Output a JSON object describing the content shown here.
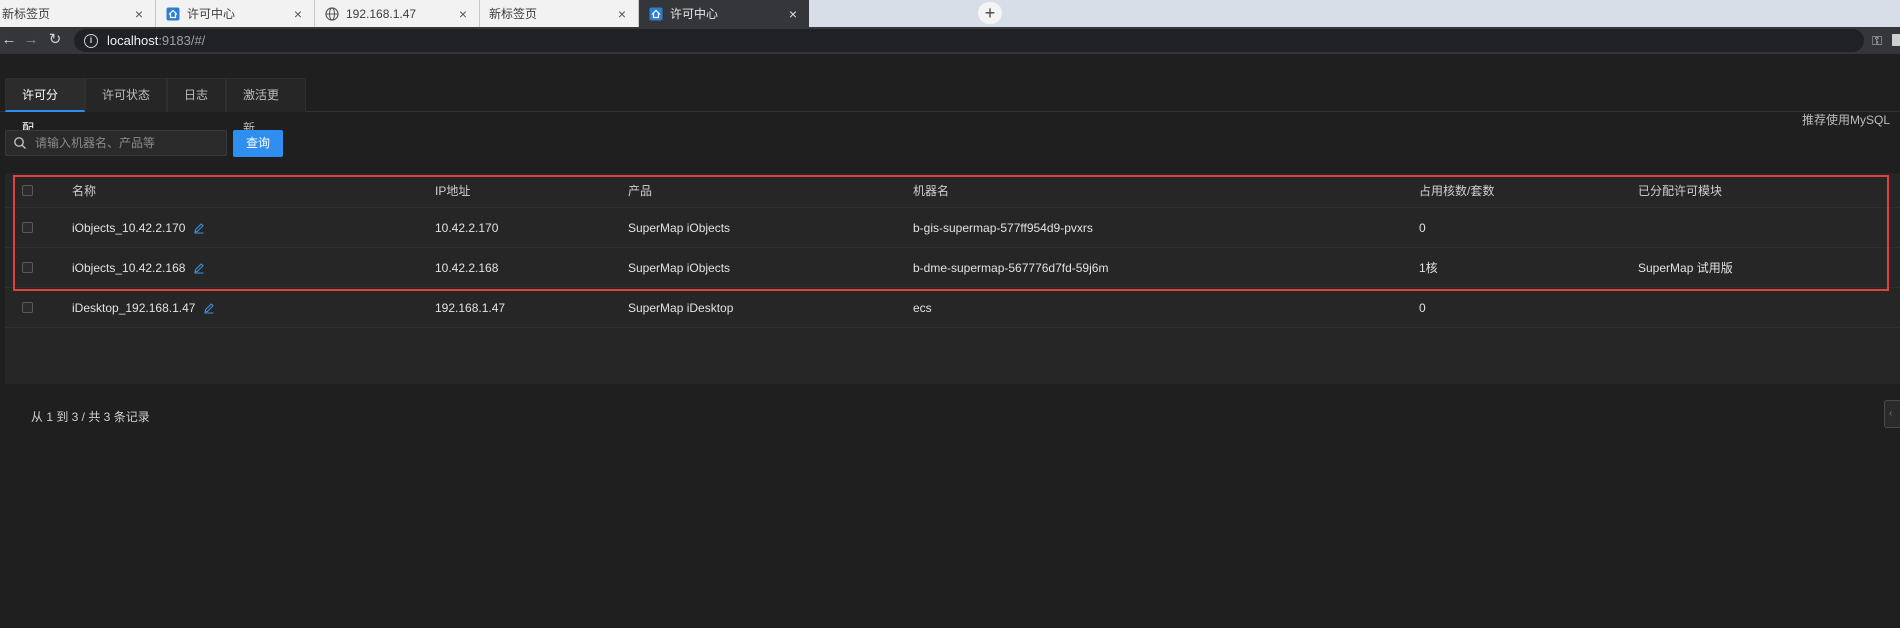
{
  "browser": {
    "tabs": [
      {
        "title": "新标签页",
        "icon": "none"
      },
      {
        "title": "许可中心",
        "icon": "house-icon"
      },
      {
        "title": "192.168.1.47",
        "icon": "globe-icon"
      },
      {
        "title": "新标签页",
        "icon": "none"
      },
      {
        "title": "许可中心",
        "icon": "house-icon",
        "active": true
      }
    ],
    "close_glyph": "×",
    "new_tab_glyph": "+",
    "address": {
      "host": "localhost",
      "rest": ":9183/#/"
    }
  },
  "app": {
    "tabs": [
      {
        "label": "许可分配",
        "active": true
      },
      {
        "label": "许可状态"
      },
      {
        "label": "日志"
      },
      {
        "label": "激活更新"
      }
    ],
    "mysql_tip": "推荐使用MySQL",
    "search": {
      "placeholder": "请输入机器名、产品等",
      "button": "查询"
    },
    "table": {
      "columns": [
        "名称",
        "IP地址",
        "产品",
        "机器名",
        "占用核数/套数",
        "已分配许可模块"
      ],
      "rows": [
        {
          "name": "iObjects_10.42.2.170",
          "ip": "10.42.2.170",
          "product": "SuperMap iObjects",
          "machine": "b-gis-supermap-577ff954d9-pvxrs",
          "cores": "0",
          "modules": ""
        },
        {
          "name": "iObjects_10.42.2.168",
          "ip": "10.42.2.168",
          "product": "SuperMap iObjects",
          "machine": "b-dme-supermap-567776d7fd-59j6m",
          "cores": "1核",
          "modules": "SuperMap 试用版"
        },
        {
          "name": "iDesktop_192.168.1.47",
          "ip": "192.168.1.47",
          "product": "SuperMap iDesktop",
          "machine": "ecs",
          "cores": "0",
          "modules": ""
        }
      ]
    },
    "footer": "从 1 到 3 / 共 3 条记录"
  },
  "colors": {
    "accent": "#2e8ff0",
    "highlight": "#e0413b",
    "background": "#1f1f20"
  }
}
